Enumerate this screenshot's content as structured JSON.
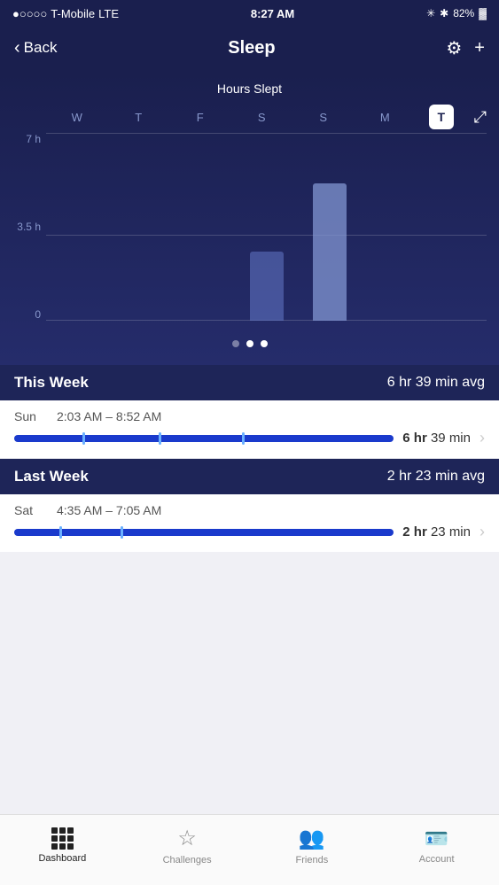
{
  "statusBar": {
    "carrier": "T-Mobile",
    "network": "LTE",
    "time": "8:27 AM",
    "battery": "82%"
  },
  "navBar": {
    "backLabel": "Back",
    "title": "Sleep",
    "gearIcon": "⚙",
    "plusIcon": "+"
  },
  "chart": {
    "title": "Hours Slept",
    "days": [
      "W",
      "T",
      "F",
      "S",
      "S",
      "M"
    ],
    "todayLabel": "T",
    "yLabels": [
      "7 h",
      "3.5 h",
      "0"
    ],
    "bars": [
      {
        "height": 0,
        "active": false
      },
      {
        "height": 0,
        "active": false
      },
      {
        "height": 0,
        "active": false
      },
      {
        "height": 80,
        "active": false
      },
      {
        "height": 160,
        "active": true
      },
      {
        "height": 0,
        "active": false
      }
    ],
    "dots": [
      false,
      true,
      true
    ]
  },
  "thisWeek": {
    "label": "This Week",
    "avg": "6 hr 39 min avg",
    "entries": [
      {
        "day": "Sun",
        "timeRange": "2:03 AM – 8:52 AM",
        "duration": "6 hr 39 min",
        "durationHr": "6 hr",
        "durationMin": "39 min",
        "ticks": [
          18,
          38,
          60
        ]
      }
    ]
  },
  "lastWeek": {
    "label": "Last Week",
    "avg": "2 hr 23 min avg",
    "entries": [
      {
        "day": "Sat",
        "timeRange": "4:35 AM – 7:05 AM",
        "duration": "2 hr 23 min",
        "durationHr": "2 hr",
        "durationMin": "23 min",
        "ticks": [
          12,
          28
        ]
      }
    ]
  },
  "tabBar": {
    "tabs": [
      {
        "label": "Dashboard",
        "active": true
      },
      {
        "label": "Challenges",
        "active": false
      },
      {
        "label": "Friends",
        "active": false
      },
      {
        "label": "Account",
        "active": false
      }
    ]
  }
}
